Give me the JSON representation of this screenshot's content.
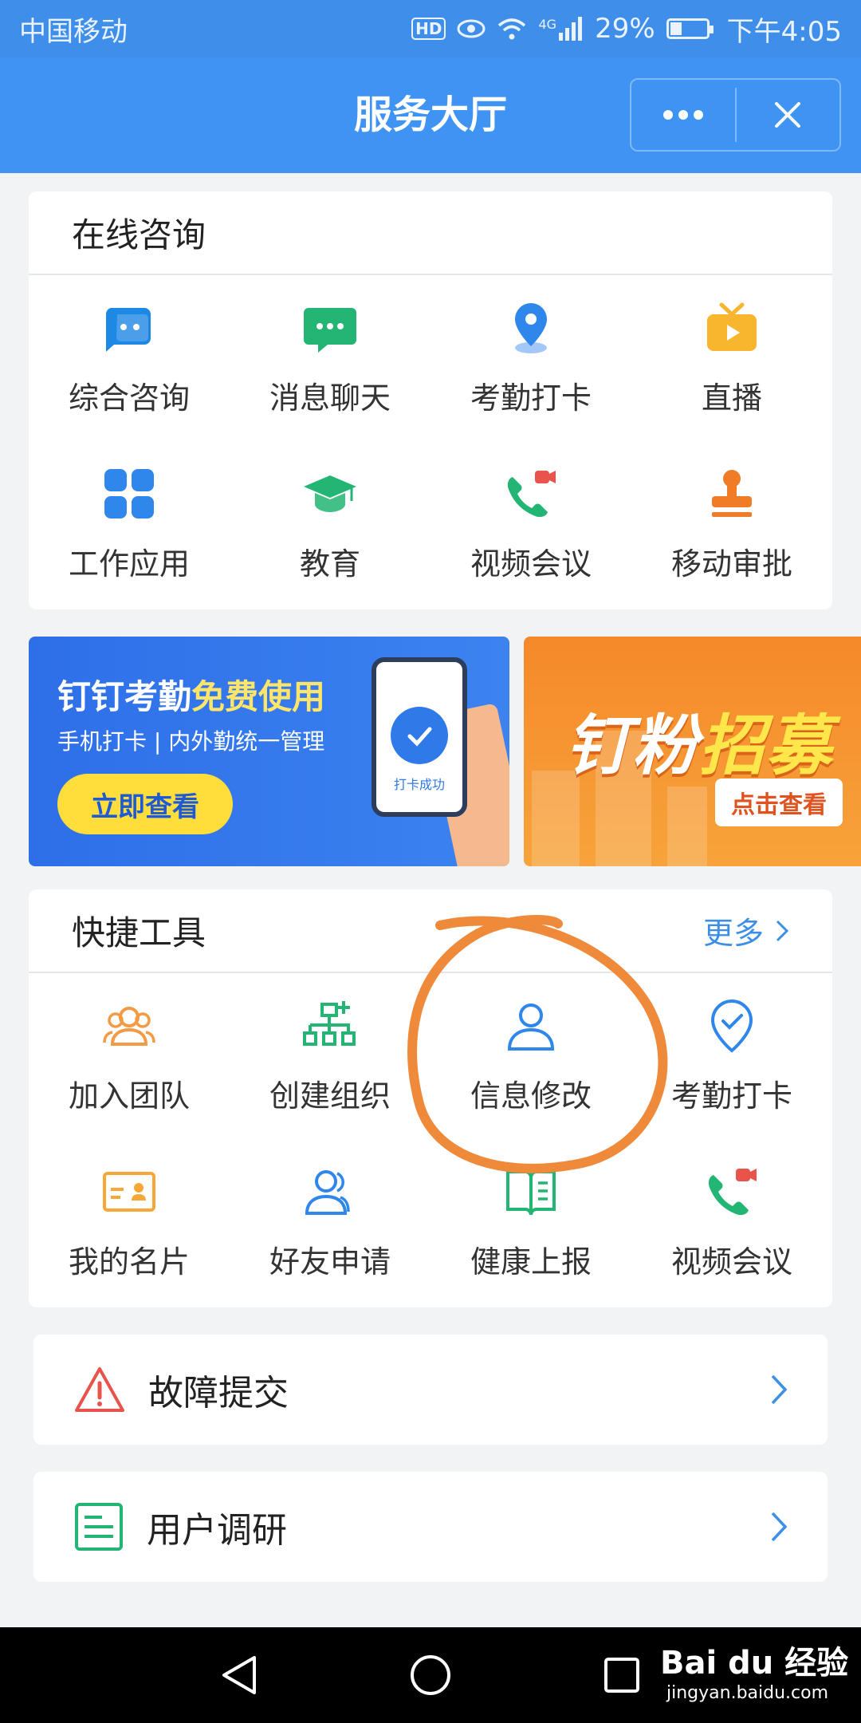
{
  "status_bar": {
    "carrier": "中国移动",
    "hd": "HD",
    "network": "4G",
    "battery": "29%",
    "battery_level": 0.29,
    "time": "下午4:05"
  },
  "header": {
    "title": "服务大厅",
    "more_icon": "ellipsis-icon",
    "close_icon": "close-icon"
  },
  "online_consult": {
    "title": "在线咨询",
    "items": [
      {
        "label": "综合咨询",
        "icon": "consult-chat-icon",
        "color": "#1e88e5"
      },
      {
        "label": "消息聊天",
        "icon": "message-bubble-icon",
        "color": "#22b573"
      },
      {
        "label": "考勤打卡",
        "icon": "location-pin-icon",
        "color": "#2f86eb"
      },
      {
        "label": "直播",
        "icon": "tv-live-icon",
        "color": "#f8b52e"
      },
      {
        "label": "工作应用",
        "icon": "app-grid-icon",
        "color": "#2f86eb"
      },
      {
        "label": "教育",
        "icon": "graduation-cap-icon",
        "color": "#22b573"
      },
      {
        "label": "视频会议",
        "icon": "video-call-icon",
        "color": "#22b573"
      },
      {
        "label": "移动审批",
        "icon": "approval-stamp-icon",
        "color": "#f07c28"
      }
    ]
  },
  "banners": {
    "left": {
      "title_part1": "钉钉考勤",
      "title_part2": "免费使用",
      "subtitle": "手机打卡 | 内外勤统一管理",
      "button": "立即查看",
      "phone_text": "打卡成功"
    },
    "right": {
      "title_part1": "钉粉",
      "title_part2": "招募",
      "button": "点击查看"
    }
  },
  "quick_tools": {
    "title": "快捷工具",
    "more": "更多",
    "items": [
      {
        "label": "加入团队",
        "icon": "join-team-icon",
        "color": "#f39a44"
      },
      {
        "label": "创建组织",
        "icon": "org-chart-icon",
        "color": "#22b573"
      },
      {
        "label": "信息修改",
        "icon": "user-profile-icon",
        "color": "#2f86eb"
      },
      {
        "label": "考勤打卡",
        "icon": "check-shield-icon",
        "color": "#2f86eb"
      },
      {
        "label": "我的名片",
        "icon": "business-card-icon",
        "color": "#f7a735"
      },
      {
        "label": "好友申请",
        "icon": "friend-request-icon",
        "color": "#2f86eb"
      },
      {
        "label": "健康上报",
        "icon": "health-book-icon",
        "color": "#22b573"
      },
      {
        "label": "视频会议",
        "icon": "video-call-icon",
        "color": "#22b573"
      }
    ]
  },
  "rows": [
    {
      "label": "故障提交",
      "icon": "warning-triangle-icon",
      "color": "#e8534b"
    },
    {
      "label": "用户调研",
      "icon": "survey-list-icon",
      "color": "#22b573"
    }
  ],
  "watermark": {
    "text": "Bai du 经验",
    "url_text": "jingyan.baidu.com"
  }
}
